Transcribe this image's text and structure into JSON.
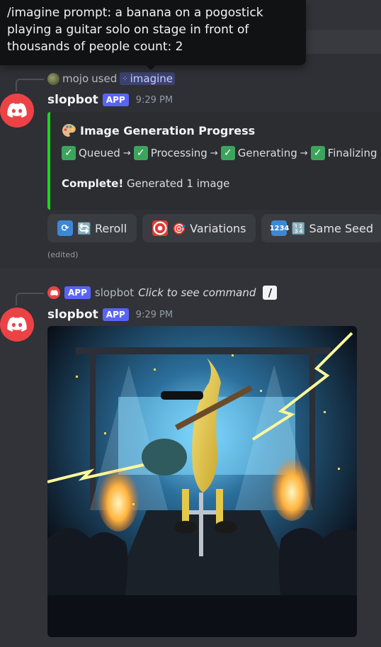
{
  "tooltip": {
    "text": "/imagine prompt: a banana on a pogostick playing a guitar solo on stage in front of thousands of people count: 2"
  },
  "message1": {
    "reply": {
      "user": "mojo",
      "action": "used",
      "command": "imagine"
    },
    "username": "slopbot",
    "badge": "APP",
    "time": "9:29 PM",
    "embed": {
      "accent_color": "#1dd61d",
      "title_emoji": "palette-icon",
      "title": "Image Generation Progress",
      "steps": [
        "Queued",
        "Processing",
        "Generating",
        "Finalizing"
      ],
      "status_bold": "Complete!",
      "status_text": "Generated 1 image"
    },
    "buttons": [
      {
        "icon": "repeat-icon",
        "label": "🔄 Reroll"
      },
      {
        "icon": "target-icon",
        "label": "🎯 Variations"
      },
      {
        "icon": "numbers-icon",
        "label": "🔢 Same Seed"
      }
    ],
    "edited": "(edited)"
  },
  "message2": {
    "reply": {
      "badge": "APP",
      "user": "slopbot",
      "text": "Click to see command"
    },
    "username": "slopbot",
    "badge": "APP",
    "time": "9:29 PM",
    "image": {
      "subject": "banana wearing sunglasses playing electric guitar on a pogo stick on a concert stage with lightning and crowd"
    }
  },
  "colors": {
    "background": "#313338",
    "blurple": "#5865f2",
    "discord_red": "#ed4245"
  }
}
